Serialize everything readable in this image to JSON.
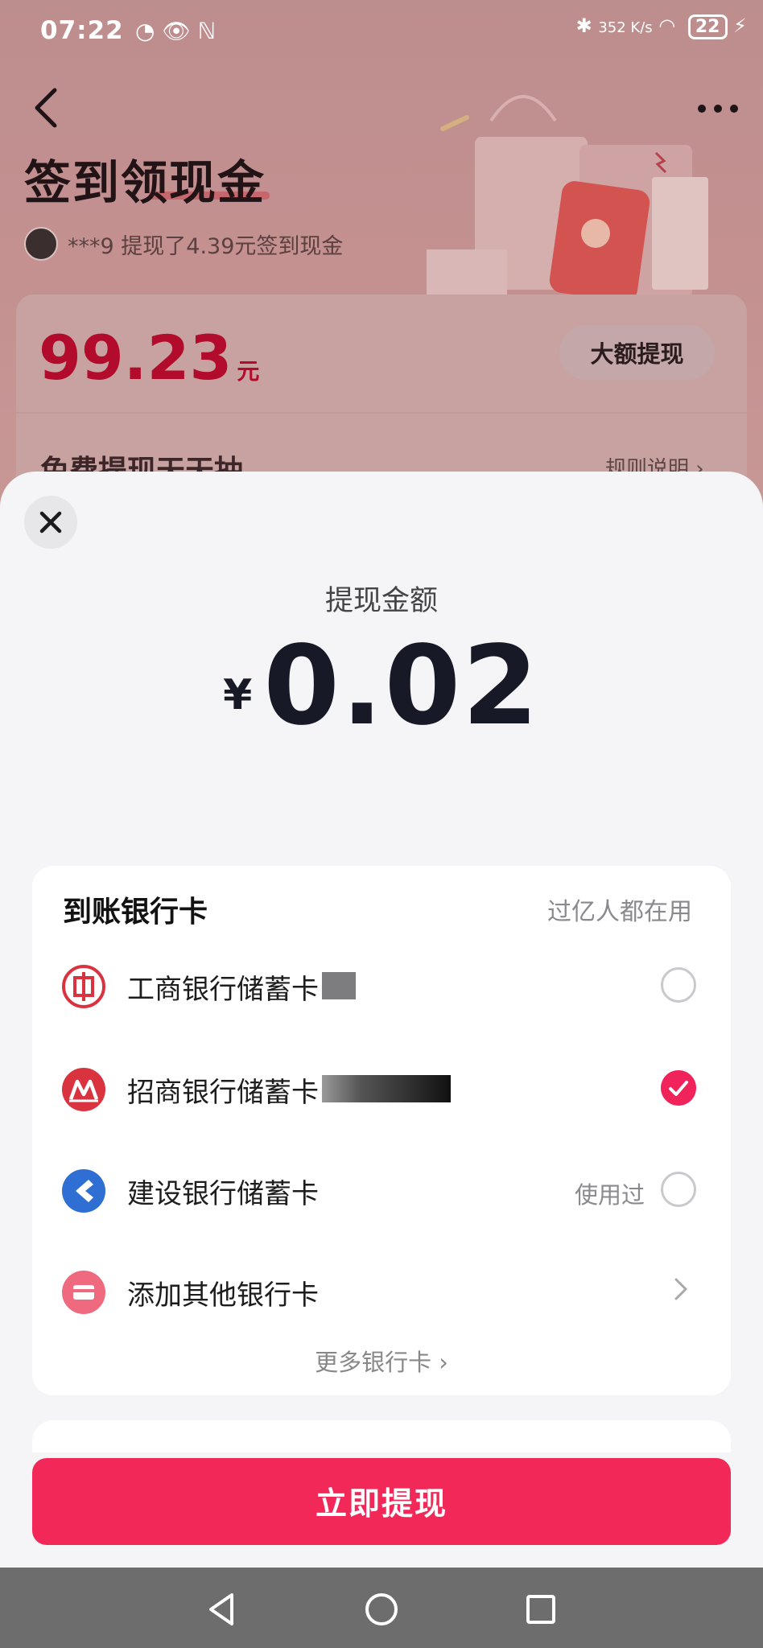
{
  "status": {
    "time": "07:22",
    "left_icons": "◔ 👁 ℕ",
    "net_speed": "352 K/s",
    "battery": "22"
  },
  "header": {
    "title": "签到领现金",
    "ticker": "***9 提现了4.39元签到现金"
  },
  "balance": {
    "amount": "99.23",
    "unit": "元",
    "big_withdraw_label": "大额提现",
    "free_text": "免费提现天天抽",
    "rules_label": "规则说明 ›"
  },
  "sheet": {
    "amount_label": "提现金额",
    "currency": "¥",
    "amount": "0.02",
    "bank_section_title": "到账银行卡",
    "bank_section_hint": "过亿人都在用",
    "banks": [
      {
        "name": "工商银行储蓄卡",
        "icon": "icbc-logo-icon",
        "selected": false,
        "used_label": ""
      },
      {
        "name": "招商银行储蓄卡",
        "icon": "cmb-logo-icon",
        "selected": true,
        "used_label": ""
      },
      {
        "name": "建设银行储蓄卡",
        "icon": "ccb-logo-icon",
        "selected": false,
        "used_label": "使用过"
      },
      {
        "name": "添加其他银行卡",
        "icon": "add-card-icon",
        "selected": false,
        "used_label": ""
      }
    ],
    "more_banks": "更多银行卡 ›",
    "withdraw_button": "立即提现"
  },
  "colors": {
    "accent": "#f12858",
    "amount_red": "#b30b2c"
  }
}
